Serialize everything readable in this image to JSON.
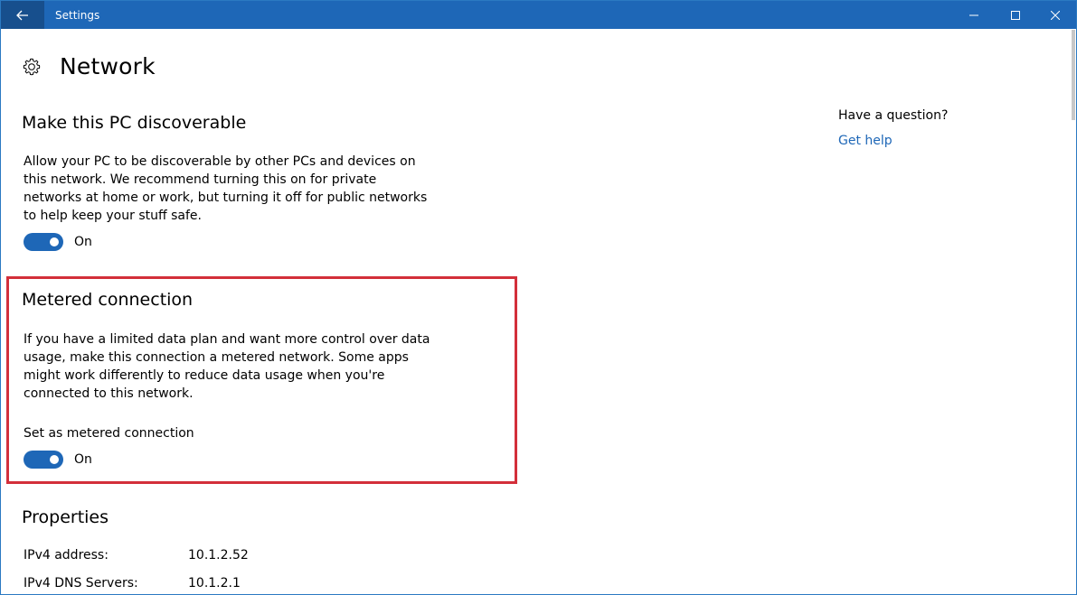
{
  "window": {
    "title": "Settings"
  },
  "header": {
    "title": "Network",
    "icon": "gear-icon"
  },
  "discoverable": {
    "title": "Make this PC discoverable",
    "description": "Allow your PC to be discoverable by other PCs and devices on this network. We recommend turning this on for private networks at home or work, but turning it off for public networks to help keep your stuff safe.",
    "toggle_state": "On",
    "toggle_on": true
  },
  "metered": {
    "title": "Metered connection",
    "description": "If you have a limited data plan and want more control over data usage, make this connection a metered network. Some apps might work differently to reduce data usage when you're connected to this network.",
    "setting_label": "Set as metered connection",
    "toggle_state": "On",
    "toggle_on": true
  },
  "properties": {
    "title": "Properties",
    "rows": [
      {
        "label": "IPv4 address:",
        "value": "10.1.2.52"
      },
      {
        "label": "IPv4 DNS Servers:",
        "value": "10.1.2.1"
      }
    ]
  },
  "sidebar": {
    "question": "Have a question?",
    "help_link": "Get help"
  },
  "colors": {
    "accent": "#1e67b7",
    "title_bar": "#1e67b7",
    "back_button": "#174f8d",
    "highlight": "#d32f3a"
  }
}
